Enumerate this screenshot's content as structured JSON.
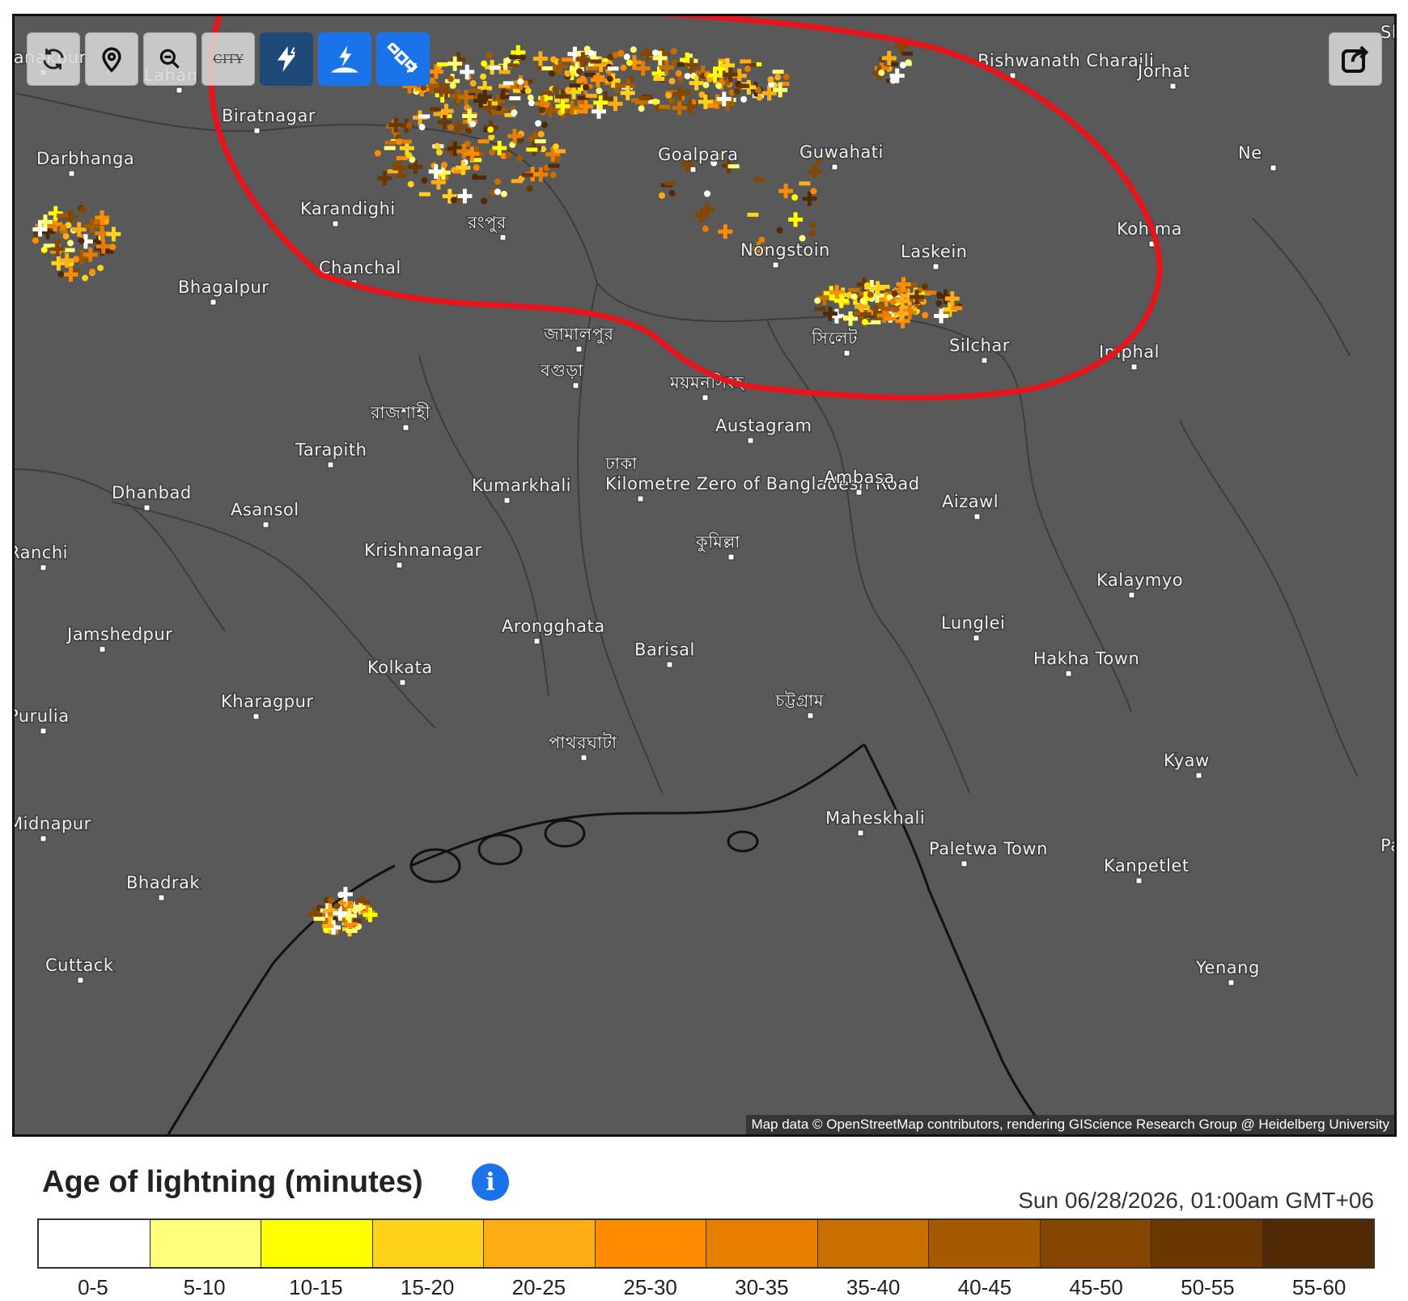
{
  "map": {
    "attribution": "Map data © OpenStreetMap contributors, rendering GIScience Research Group @ Heidelberg University",
    "background_color": "#595959",
    "annotation_color": "#e8141c",
    "cities": [
      {
        "name": "Lahan"
      },
      {
        "name": "Biratnagar"
      },
      {
        "name": "Darbhanga"
      },
      {
        "name": "Karandighi"
      },
      {
        "name": "Chanchal"
      },
      {
        "name": "Bhagalpur"
      },
      {
        "name": "রংপুর"
      },
      {
        "name": "Goalpara"
      },
      {
        "name": "Guwahati"
      },
      {
        "name": "Bishwanath Charaili"
      },
      {
        "name": "Jorhat"
      },
      {
        "name": "Kohima"
      },
      {
        "name": "Nongstoin"
      },
      {
        "name": "Laskein"
      },
      {
        "name": "Silchar"
      },
      {
        "name": "Imphal"
      },
      {
        "name": "জামালপুর"
      },
      {
        "name": "বগুড়া"
      },
      {
        "name": "ময়মনসিংহ"
      },
      {
        "name": "সিলেট"
      },
      {
        "name": "রাজশাহী"
      },
      {
        "name": "Austagram"
      },
      {
        "name": "Tarapith"
      },
      {
        "name": "ঢাকা;Kilometre Zero of Bangladesh Road"
      },
      {
        "name": "Kumarkhali"
      },
      {
        "name": "Ambasa"
      },
      {
        "name": "Aizawl"
      },
      {
        "name": "Dhanbad"
      },
      {
        "name": "Asansol"
      },
      {
        "name": "কুমিল্লা"
      },
      {
        "name": "Krishnanagar"
      },
      {
        "name": "Kalaymyo"
      },
      {
        "name": "Jamshedpur"
      },
      {
        "name": "Arongghata"
      },
      {
        "name": "Lunglei"
      },
      {
        "name": "Barisal"
      },
      {
        "name": "Kolkata"
      },
      {
        "name": "Hakha Town"
      },
      {
        "name": "Kharagpur"
      },
      {
        "name": "চট্টগ্রাম"
      },
      {
        "name": "পাথরঘাটা"
      },
      {
        "name": "Kyaw"
      },
      {
        "name": "Maheskhali"
      },
      {
        "name": "Paletwa Town"
      },
      {
        "name": "Kanpetlet"
      },
      {
        "name": "Bhadrak"
      },
      {
        "name": "Cuttack"
      },
      {
        "name": "Yenang"
      },
      {
        "name": "Janakpur"
      },
      {
        "name": "Ranchi"
      },
      {
        "name": "Purulia"
      },
      {
        "name": "Midnapur"
      },
      {
        "name": "Ne"
      },
      {
        "name": "Sh"
      },
      {
        "name": "Pa"
      }
    ]
  },
  "toolbar": {
    "buttons": [
      {
        "name": "refresh-button",
        "icon": "refresh-icon"
      },
      {
        "name": "locate-button",
        "icon": "map-pin-icon"
      },
      {
        "name": "zoom-out-button",
        "icon": "zoom-out-icon"
      },
      {
        "name": "city-labels-button",
        "icon": "city-labels-icon",
        "icon_text": "CITY"
      },
      {
        "name": "lightning-layer-button",
        "icon": "lightning-icon"
      },
      {
        "name": "ground-strike-button",
        "icon": "ground-lightning-icon"
      },
      {
        "name": "satellite-button",
        "icon": "satellite-icon"
      }
    ],
    "share_icon": "share-icon"
  },
  "legend": {
    "title": "Age of lightning (minutes)",
    "info_glyph": "i",
    "timestamp": "Sun 06/28/2026, 01:00am GMT+06",
    "bins": [
      {
        "label": "0-5",
        "color": "#ffffff"
      },
      {
        "label": "5-10",
        "color": "#ffff7a"
      },
      {
        "label": "10-15",
        "color": "#ffff00"
      },
      {
        "label": "15-20",
        "color": "#ffd21c"
      },
      {
        "label": "20-25",
        "color": "#ffad14"
      },
      {
        "label": "25-30",
        "color": "#ff8c00"
      },
      {
        "label": "30-35",
        "color": "#e67e00"
      },
      {
        "label": "35-40",
        "color": "#c96f00"
      },
      {
        "label": "40-45",
        "color": "#a65a00"
      },
      {
        "label": "45-50",
        "color": "#854600"
      },
      {
        "label": "50-55",
        "color": "#6a3700"
      },
      {
        "label": "55-60",
        "color": "#512a05"
      }
    ]
  }
}
